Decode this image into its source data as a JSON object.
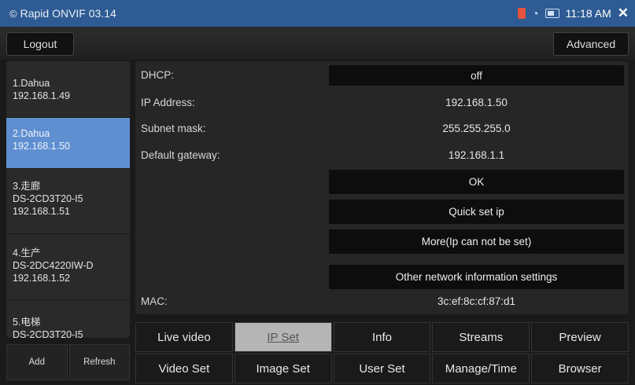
{
  "status": {
    "app_title": "Rapid ONVIF 03.14",
    "time": "11:18 AM"
  },
  "topbar": {
    "logout": "Logout",
    "advanced": "Advanced"
  },
  "devices": [
    {
      "line1": "1.Dahua",
      "line2": "192.168.1.49",
      "line3": ""
    },
    {
      "line1": "2.Dahua",
      "line2": "192.168.1.50",
      "line3": ""
    },
    {
      "line1": "3.走廊",
      "line2": "DS-2CD3T20-I5",
      "line3": "192.168.1.51"
    },
    {
      "line1": "4.生产",
      "line2": "DS-2DC4220IW-D",
      "line3": "192.168.1.52"
    },
    {
      "line1": "5.电梯",
      "line2": "DS-2CD3T20-I5",
      "line3": ""
    }
  ],
  "sidebar_buttons": {
    "add": "Add",
    "refresh": "Refresh"
  },
  "network": {
    "dhcp_label": "DHCP:",
    "dhcp_value": "off",
    "ip_label": "IP Address:",
    "ip_value": "192.168.1.50",
    "mask_label": "Subnet mask:",
    "mask_value": "255.255.255.0",
    "gateway_label": "Default gateway:",
    "gateway_value": "192.168.1.1",
    "mac_label": "MAC:",
    "mac_value": "3c:ef:8c:cf:87:d1"
  },
  "actions": {
    "ok": "OK",
    "quick": "Quick set ip",
    "more": "More(Ip can not be set)",
    "other": "Other network information settings"
  },
  "tabs": {
    "live": "Live video",
    "ipset": "IP Set",
    "info": "Info",
    "streams": "Streams",
    "preview": "Preview",
    "videoset": "Video Set",
    "imageset": "Image Set",
    "userset": "User Set",
    "manage": "Manage/Time",
    "browser": "Browser"
  },
  "colors": {
    "statusbar": "#2e5b93",
    "selected_device": "#5f8fd0",
    "active_tab": "#b5b5b5"
  }
}
